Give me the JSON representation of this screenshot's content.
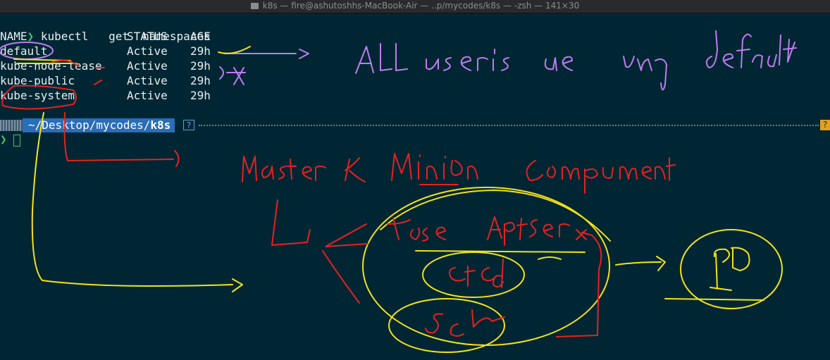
{
  "window": {
    "title": "k8s — fire@ashutoshhs-MacBook-Air — ..p/mycodes/k8s — -zsh — 141×30"
  },
  "terminal": {
    "prompt_symbol": "❯",
    "command": "kubectl   get  namespaces",
    "headers": {
      "name": "NAME",
      "status": "STATUS",
      "age": "AGE"
    },
    "rows": [
      {
        "name": "default",
        "status": "Active",
        "age": "29h"
      },
      {
        "name": "kube-node-lease",
        "status": "Active",
        "age": "29h"
      },
      {
        "name": "kube-public",
        "status": "Active",
        "age": "29h"
      },
      {
        "name": "kube-system",
        "status": "Active",
        "age": "29h"
      }
    ],
    "prompt_path_prefix": "~/Desktop/mycodes/",
    "prompt_path_dir": "k8s",
    "prompt_help": "?",
    "prompt_end": "?"
  },
  "colors": {
    "background": "#002633",
    "prompt_green": "#4ec26a",
    "path_blue": "#2a6db8",
    "ink_yellow": "#f4e21a",
    "ink_purple": "#c07cf0",
    "ink_red": "#e82020"
  }
}
